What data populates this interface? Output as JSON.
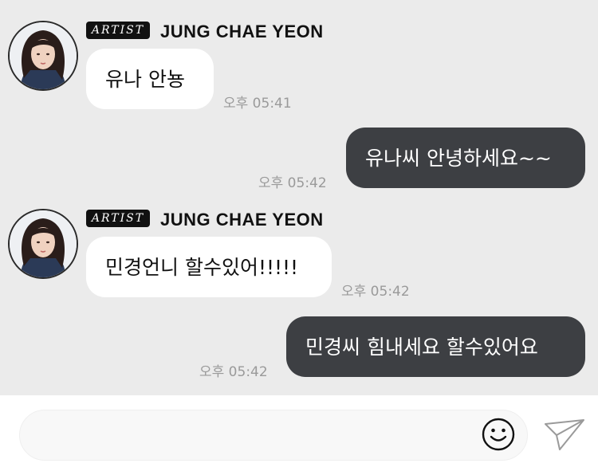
{
  "messages": [
    {
      "direction": "incoming",
      "badge": "ARTIST",
      "sender": "JUNG CHAE YEON",
      "text": "유나 안뇽",
      "time": "오후 05:41"
    },
    {
      "direction": "outgoing",
      "text": "유나씨 안녕하세요~~",
      "time": "오후 05:42"
    },
    {
      "direction": "incoming",
      "badge": "ARTIST",
      "sender": "JUNG CHAE YEON",
      "text": "민경언니 할수있어!!!!!",
      "time": "오후 05:42"
    },
    {
      "direction": "outgoing",
      "text": "민경씨 힘내세요 할수있어요",
      "time": "오후 05:42"
    }
  ],
  "composer": {
    "placeholder": ""
  },
  "icons": {
    "emoji": "smiley-face-icon",
    "send": "paper-plane-send-icon"
  },
  "colors": {
    "background": "#ebebeb",
    "incoming_bubble": "#ffffff",
    "outgoing_bubble": "#3d3f43",
    "timestamp": "#9a9a9a",
    "badge": "#111111"
  }
}
